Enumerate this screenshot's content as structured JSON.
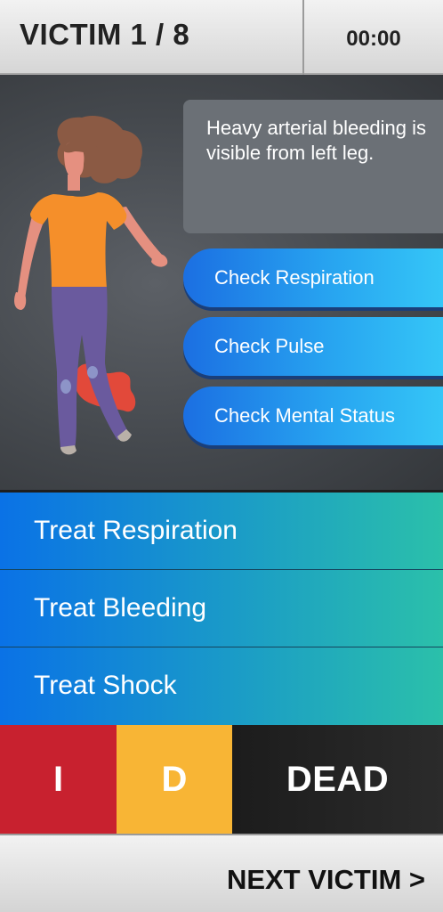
{
  "header": {
    "victim_counter": "VICTIM 1 / 8",
    "timer": "00:00"
  },
  "scene": {
    "description": "Heavy arterial bleeding is visible from left leg.",
    "checks": [
      {
        "label": "Check Respiration"
      },
      {
        "label": "Check Pulse"
      },
      {
        "label": "Check Mental Status"
      }
    ]
  },
  "treatments": [
    {
      "label": "Treat Respiration"
    },
    {
      "label": "Treat Bleeding"
    },
    {
      "label": "Treat Shock"
    }
  ],
  "triage": {
    "immediate_label": "I",
    "delayed_label": "D",
    "dead_label": "DEAD"
  },
  "footer": {
    "next_label": "NEXT VICTIM >"
  },
  "colors": {
    "immediate": "#c8212f",
    "delayed": "#f8b535",
    "dead": "#1c1c1c",
    "check_button": "#1b6fe2",
    "treat_start": "#0a72e6",
    "treat_end": "#2bc0aa"
  }
}
